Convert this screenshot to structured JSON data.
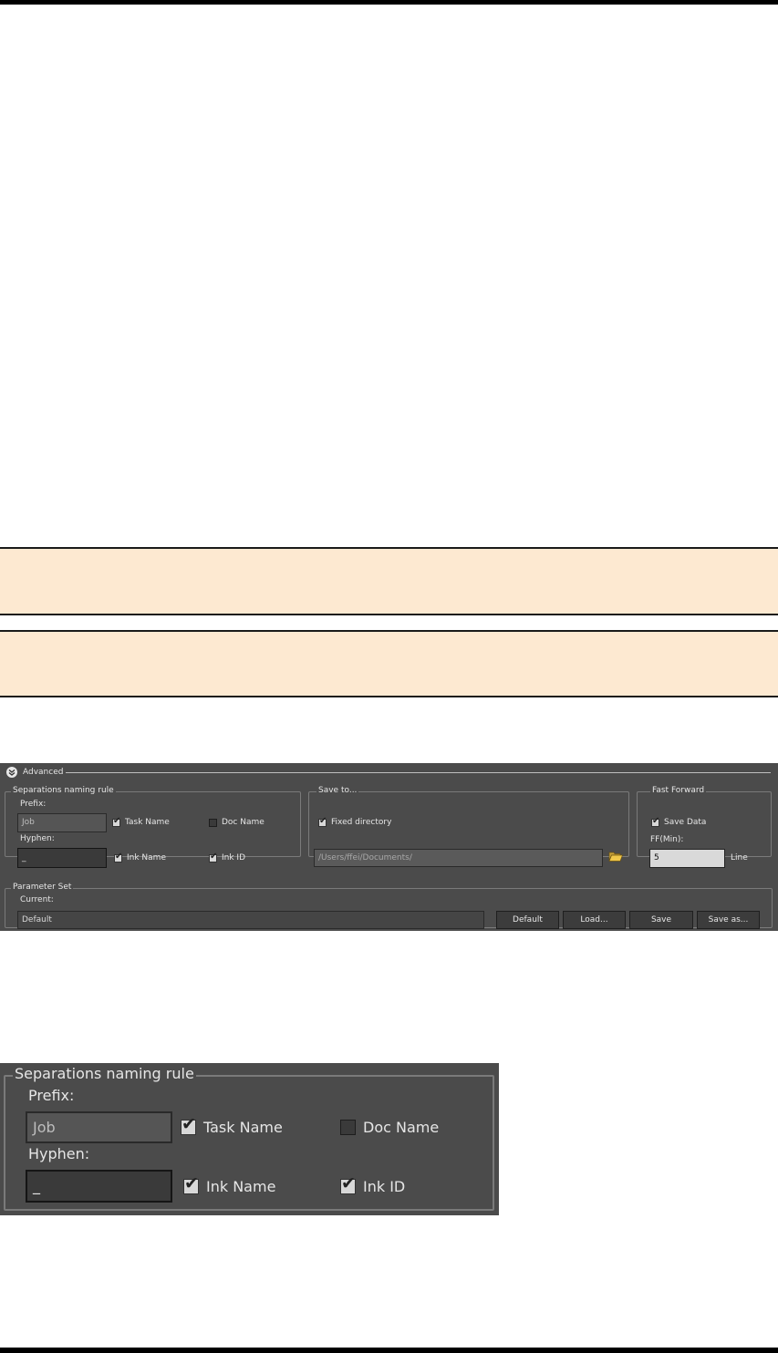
{
  "advanced_panel": {
    "section_title": "Advanced",
    "naming_rule": {
      "legend": "Separations naming rule",
      "prefix_label": "Prefix:",
      "prefix_value": "Job",
      "hyphen_label": "Hyphen:",
      "hyphen_value": "_",
      "task_name": "Task Name",
      "doc_name": "Doc Name",
      "ink_name": "Ink Name",
      "ink_id": "Ink ID"
    },
    "save_to": {
      "legend": "Save to...",
      "fixed_directory": "Fixed directory",
      "path_value": "/Users/ffei/Documents/"
    },
    "fast_forward": {
      "legend": "Fast Forward",
      "save_data": "Save Data",
      "ff_label": "FF(Min):",
      "ff_value": "5",
      "unit": "Line"
    },
    "parameter_set": {
      "legend": "Parameter Set",
      "current_label": "Current:",
      "current_value": "Default",
      "buttons": {
        "default": "Default",
        "load": "Load...",
        "save": "Save",
        "save_as": "Save as..."
      }
    }
  },
  "zoom_panel": {
    "legend": "Separations naming rule",
    "prefix_label": "Prefix:",
    "prefix_value": "Job",
    "hyphen_label": "Hyphen:",
    "hyphen_value": "_",
    "task_name": "Task Name",
    "doc_name": "Doc Name",
    "ink_name": "Ink Name",
    "ink_id": "Ink ID"
  },
  "checkbox_states": {
    "task_name": true,
    "doc_name": false,
    "ink_name": true,
    "ink_id": true,
    "fixed_directory": true,
    "save_data": true
  },
  "colors": {
    "panel_bg": "#4b4b4b",
    "note_bg": "#fde9d1"
  },
  "icons": [
    "advanced-collapse-icon",
    "folder-open-icon"
  ]
}
